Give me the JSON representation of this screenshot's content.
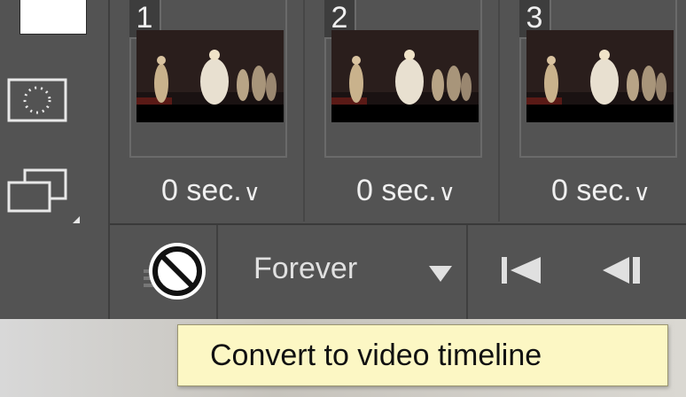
{
  "frames": [
    {
      "number": "1",
      "delay": "0 sec."
    },
    {
      "number": "2",
      "delay": "0 sec."
    },
    {
      "number": "3",
      "delay": "0 sec."
    }
  ],
  "icons": {
    "delay_dropdown": "chevron-down-icon",
    "marquee": "selection-icon",
    "duplicate": "duplicate-layers-icon",
    "convert": "no-entry-icon",
    "first_frame": "skip-to-first-icon",
    "previous_frame": "step-back-icon"
  },
  "controls": {
    "loop_option": "Forever"
  },
  "tooltip": {
    "text": "Convert to video timeline"
  },
  "colors": {
    "panel_bg": "#535353",
    "text": "#efefef",
    "tooltip_bg": "#fcf7c4"
  }
}
